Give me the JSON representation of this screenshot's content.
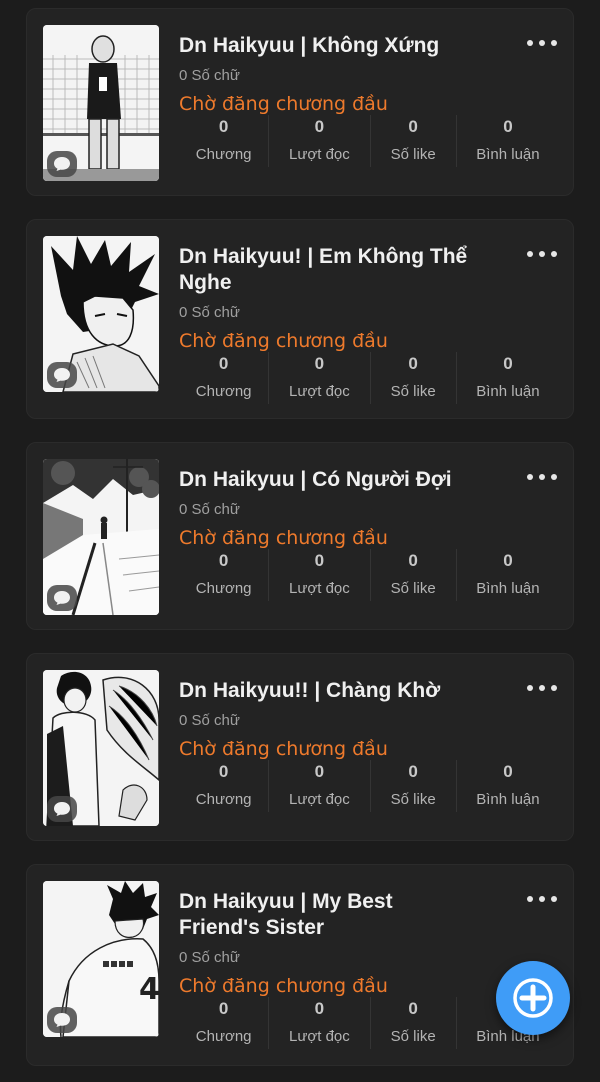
{
  "stories": [
    {
      "title": "Dn Haikyuu | Không Xứng",
      "word_count": "0 Số chữ",
      "status": "Chờ đăng chương đầu",
      "stats": [
        {
          "value": "0",
          "label": "Chương"
        },
        {
          "value": "0",
          "label": "Lượt đọc"
        },
        {
          "value": "0",
          "label": "Số like"
        },
        {
          "value": "0",
          "label": "Bình luận"
        }
      ]
    },
    {
      "title": "Dn Haikyuu! | Em Không Thể Nghe",
      "word_count": "0 Số chữ",
      "status": "Chờ đăng chương đầu",
      "stats": [
        {
          "value": "0",
          "label": "Chương"
        },
        {
          "value": "0",
          "label": "Lượt đọc"
        },
        {
          "value": "0",
          "label": "Số like"
        },
        {
          "value": "0",
          "label": "Bình luận"
        }
      ]
    },
    {
      "title": "Dn Haikyuu | Có Người Đợi",
      "word_count": "0 Số chữ",
      "status": "Chờ đăng chương đầu",
      "stats": [
        {
          "value": "0",
          "label": "Chương"
        },
        {
          "value": "0",
          "label": "Lượt đọc"
        },
        {
          "value": "0",
          "label": "Số like"
        },
        {
          "value": "0",
          "label": "Bình luận"
        }
      ]
    },
    {
      "title": "Dn Haikyuu!! | Chàng Khờ",
      "word_count": "0 Số chữ",
      "status": "Chờ đăng chương đầu",
      "stats": [
        {
          "value": "0",
          "label": "Chương"
        },
        {
          "value": "0",
          "label": "Lượt đọc"
        },
        {
          "value": "0",
          "label": "Số like"
        },
        {
          "value": "0",
          "label": "Bình luận"
        }
      ]
    },
    {
      "title": "Dn Haikyuu | My Best Friend's Sister",
      "word_count": "0 Số chữ",
      "status": "Chờ đăng chương đầu",
      "stats": [
        {
          "value": "0",
          "label": "Chương"
        },
        {
          "value": "0",
          "label": "Lượt đọc"
        },
        {
          "value": "0",
          "label": "Số like"
        },
        {
          "value": "0",
          "label": "Bình luận"
        }
      ]
    }
  ],
  "icons": {
    "more": "more-horizontal-icon",
    "cover_badge": "comment-bubble-icon",
    "fab": "plus-icon"
  },
  "colors": {
    "background": "#1c1c1c",
    "card": "#232323",
    "status": "#ee7a2c",
    "fab": "#3f9cf7"
  }
}
